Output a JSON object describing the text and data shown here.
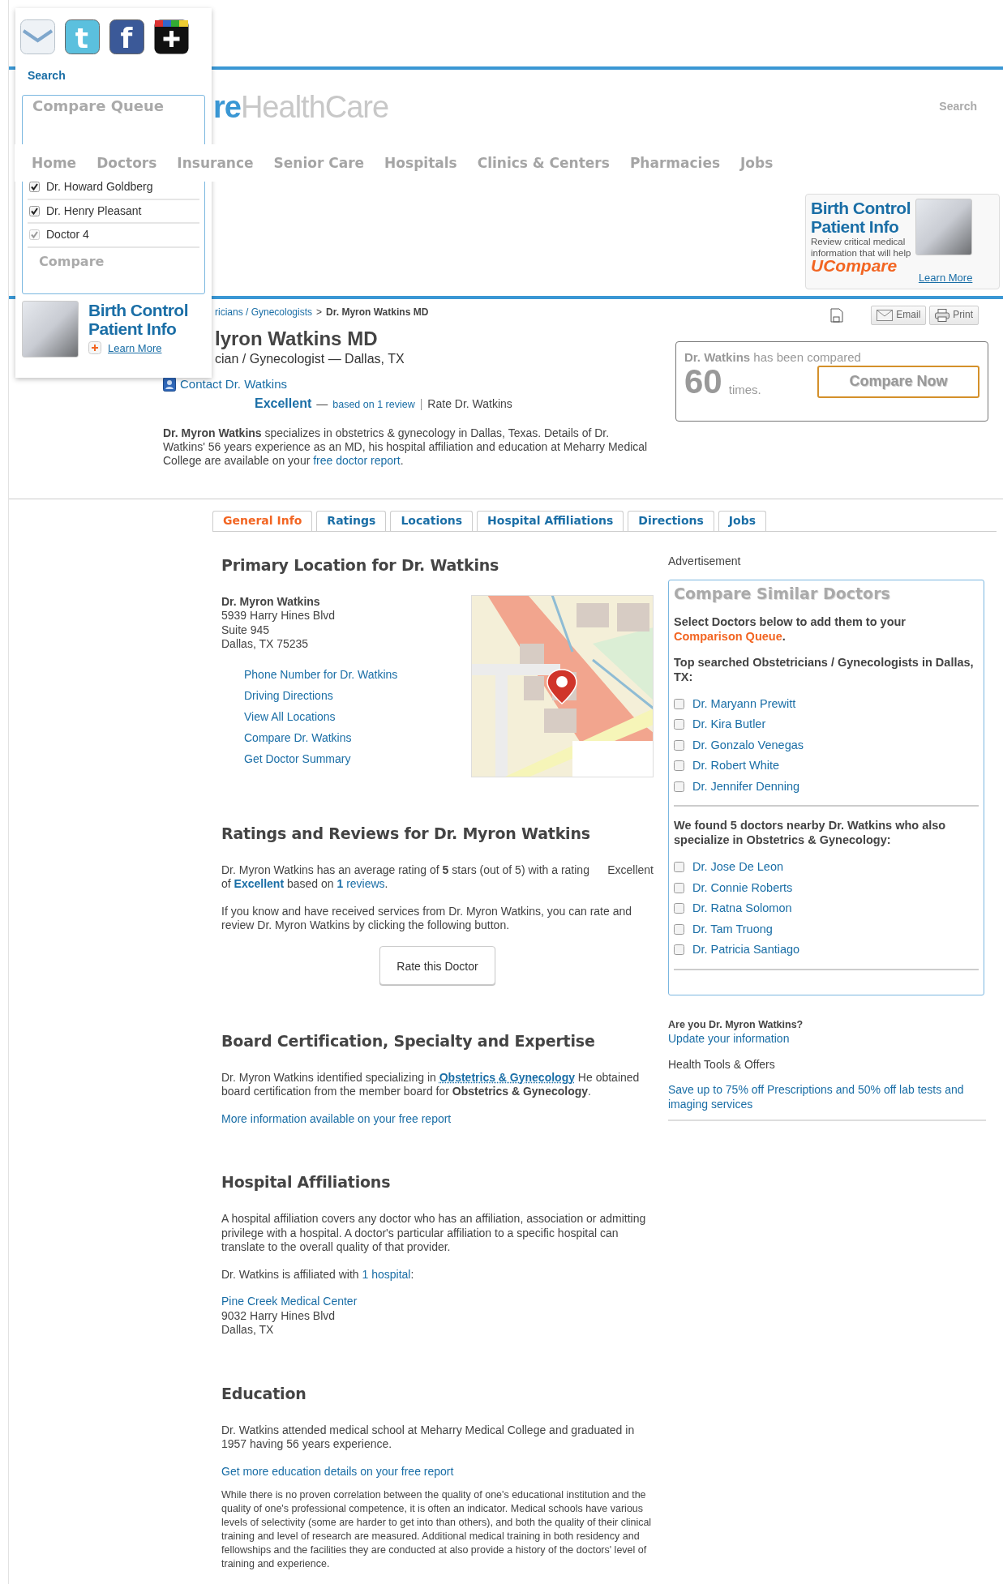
{
  "overlay": {
    "share_icons": [
      {
        "kind": "envelope"
      },
      {
        "kind": "letter",
        "glyph": "t",
        "color": "#5bc0de"
      },
      {
        "kind": "letter",
        "glyph": "f",
        "color": "#3b5998"
      },
      {
        "kind": "plus"
      }
    ],
    "search_link": "Search",
    "queue": {
      "title": "Compare Queue",
      "items": [
        {
          "name": "Dr. Howard Goldberg",
          "checked": true,
          "disabled": false
        },
        {
          "name": "Dr. Henry Pleasant",
          "checked": true,
          "disabled": false
        },
        {
          "name": "Doctor 4",
          "checked": true,
          "disabled": true
        }
      ],
      "compare_button": "Compare"
    },
    "ad": {
      "title_lines": [
        "Birth Control",
        "Patient Info"
      ],
      "link": "Learn More"
    }
  },
  "header": {
    "logo_accent": "re",
    "logo_rest": "HealthCare",
    "search_link": "Search",
    "nav": [
      "Home",
      "Doctors",
      "Insurance",
      "Senior Care",
      "Hospitals",
      "Clinics & Centers",
      "Pharmacies",
      "Jobs"
    ],
    "ad": {
      "title_lines": [
        "Birth Control",
        "Patient Info"
      ],
      "description_lines": [
        "Review critical medical",
        "information that will help"
      ],
      "brand": "UCompare",
      "link": "Learn More"
    }
  },
  "profile": {
    "breadcrumb": [
      {
        "text": "ricians / Gynecologists",
        "kind": "link"
      },
      {
        "text": ">",
        "kind": "sep"
      },
      {
        "text": "Dr. Myron Watkins MD",
        "kind": "current"
      }
    ],
    "name": "lyron Watkins MD",
    "subtitle": "cian / Gynecologist — Dallas, TX",
    "contact_link": "Contact Dr. Watkins",
    "rating": [
      {
        "text": "Excellent",
        "kind": "boldlink"
      },
      {
        "text": "—",
        "kind": "text"
      },
      {
        "text": "based on 1 review",
        "kind": "smalllink"
      },
      {
        "text": "|",
        "kind": "sep"
      },
      {
        "text": "Rate Dr. Watkins",
        "kind": "link"
      }
    ],
    "summary": [
      {
        "text": "**Dr. Myron Watkins** specializes in obstetrics & gynecology in Dallas, Texas. Details of Dr. Watkins' 56 years experience as an MD, his hospital affiliation and education at Meharry Medical College are available on your ",
        "kind": "text"
      },
      {
        "text": "free doctor report",
        "kind": "link"
      },
      {
        "text": ".",
        "kind": "text"
      }
    ],
    "actions": [
      "Email",
      "Print"
    ],
    "compared": {
      "name": "Dr. Watkins",
      "text": "has been compared",
      "count": "60",
      "unit": "times.",
      "button": "Compare Now"
    }
  },
  "tabs": [
    {
      "label": "General Info",
      "selected": true
    },
    {
      "label": "Ratings",
      "selected": false
    },
    {
      "label": "Locations",
      "selected": false
    },
    {
      "label": "Hospital Affiliations",
      "selected": false
    },
    {
      "label": "Directions",
      "selected": false
    },
    {
      "label": "Jobs",
      "selected": false
    }
  ],
  "location": {
    "heading": "Primary Location for Dr. Watkins",
    "doctor": "Dr. Myron Watkins",
    "address_lines": [
      "5939 Harry Hines Blvd",
      "Suite 945",
      "Dallas, TX 75235"
    ],
    "links": [
      "Phone Number for Dr. Watkins",
      "Driving Directions",
      "View All Locations",
      "Compare Dr. Watkins",
      "Get Doctor Summary"
    ]
  },
  "ratings": {
    "heading": "Ratings and Reviews for Dr. Myron Watkins",
    "rating_label": "Excellent",
    "summary": [
      {
        "text": "Dr. Myron Watkins has an average rating of **5** stars (out of 5) with a rating of ",
        "kind": "text"
      },
      {
        "text": "Excellent",
        "kind": "boldlink"
      },
      {
        "text": " based on ",
        "kind": "text"
      },
      {
        "text": "**1** reviews",
        "kind": "link"
      },
      {
        "text": ".",
        "kind": "text"
      }
    ],
    "prompt": "If you know and have received services from Dr. Myron Watkins, you can rate and review Dr. Myron Watkins by clicking the following button.",
    "button": "Rate this Doctor"
  },
  "board": {
    "heading": "Board Certification, Specialty and Expertise",
    "text": [
      {
        "text": "Dr. Myron Watkins identified specializing in ",
        "kind": "text"
      },
      {
        "text": "Obstetrics & Gynecology",
        "kind": "dottedlink"
      },
      {
        "text": " He obtained board certification from the member board for **Obstetrics & Gynecology**.",
        "kind": "text"
      }
    ],
    "link": "More information available on your free report"
  },
  "hospitals": {
    "heading": "Hospital Affiliations",
    "intro": "A hospital affiliation covers any doctor who has an affiliation, association or admitting privilege with a hospital. A doctor's particular affiliation to a specific hospital can translate to the overall quality of that provider.",
    "affiliated": [
      {
        "text": "Dr. Watkins is affiliated with ",
        "kind": "text"
      },
      {
        "text": "1 hospital",
        "kind": "link"
      },
      {
        "text": ":",
        "kind": "text"
      }
    ],
    "hospital": {
      "name": "Pine Creek Medical Center",
      "address_lines": [
        "9032 Harry Hines Blvd",
        "Dallas, TX"
      ]
    }
  },
  "education": {
    "heading": "Education",
    "text": "Dr. Watkins attended medical school at Meharry Medical College and graduated in 1957 having 56 years experience.",
    "link": "Get more education details on your free report",
    "note": "While there is no proven correlation between the quality of one's educational institution and the quality of one's professional competence, it is often an indicator. Medical schools have various levels of selectivity (some are harder to get into than others), and both the quality of their clinical training and level of research are measured. Additional medical training in both residency and fellowships and the facilities they are conducted at also provide a history of the doctors' level of training and experience."
  },
  "sidebar": {
    "ad_label": "Advertisement",
    "similar": {
      "title": "Compare Similar Doctors",
      "instruction": [
        {
          "text": "Select Doctors below to add them to your ",
          "kind": "text"
        },
        {
          "text": "Comparison Queue",
          "kind": "accent"
        },
        {
          "text": ".",
          "kind": "text"
        }
      ],
      "groups": [
        {
          "heading": "Top searched Obstetricians / Gynecologists in Dallas, TX:",
          "doctors": [
            {
              "name": "Dr. Maryann Prewitt",
              "checked": false
            },
            {
              "name": "Dr. Kira Butler",
              "checked": false
            },
            {
              "name": "Dr. Gonzalo Venegas",
              "checked": false
            },
            {
              "name": "Dr. Robert White",
              "checked": false
            },
            {
              "name": "Dr. Jennifer Denning",
              "checked": false
            }
          ]
        },
        {
          "heading": "We found 5 doctors nearby Dr. Watkins who also specialize in Obstetrics & Gynecology:",
          "doctors": [
            {
              "name": "Dr. Jose De Leon",
              "checked": false
            },
            {
              "name": "Dr. Connie Roberts",
              "checked": false
            },
            {
              "name": "Dr. Ratna Solomon",
              "checked": false
            },
            {
              "name": "Dr. Tam Truong",
              "checked": false
            },
            {
              "name": "Dr. Patricia Santiago",
              "checked": false
            }
          ]
        }
      ]
    },
    "claim_question": "Are you Dr. Myron Watkins?",
    "claim_link": "Update your information",
    "tools_label": "Health Tools & Offers",
    "offer_link": "Save up to 75% off Prescriptions and 50% off lab tests and imaging services"
  }
}
